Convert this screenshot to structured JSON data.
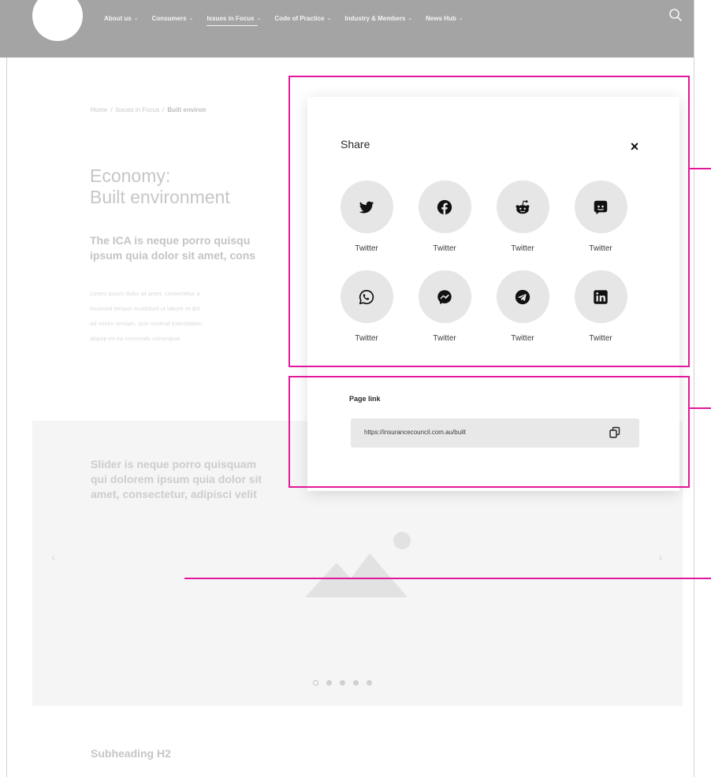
{
  "nav": {
    "items": [
      {
        "label": "About us",
        "chevron": "⌄"
      },
      {
        "label": "Consumers",
        "chevron": "⌄"
      },
      {
        "label": "Issues in Focus",
        "chevron": "⌄"
      },
      {
        "label": "Code of Practice",
        "chevron": "⌄"
      },
      {
        "label": "Industry & Members",
        "chevron": "⌄"
      },
      {
        "label": "News Hub",
        "chevron": "⌄"
      }
    ],
    "active_item": "Issues in Focus",
    "search_icon": "search-icon"
  },
  "breadcrumb": {
    "home": "Home",
    "section": "Issues in Focus",
    "current": "Built environ",
    "separator": "/"
  },
  "page": {
    "title_line1": "Economy:",
    "title_line2": "Built environment",
    "intro_line1": "The ICA is neque porro quisqu",
    "intro_line2": "ipsum quia dolor sit amet, cons",
    "body_lines": [
      "Lorem ipsum dolor sit amet, consectetur a",
      "eiusmod tempor incididunt ut labore et dol",
      "ad minim veniam, quis nostrud exercitation",
      "aliquip ex ea commodo consequat."
    ],
    "subheading": "Subheading H2"
  },
  "slider": {
    "text_line1": "Slider is neque porro quisquam",
    "text_line2": "qui dolorem ipsum quia dolor sit",
    "text_line3": "amet, consectetur, adipisci velit",
    "prev_arrow": "‹",
    "next_arrow": "›",
    "dot_count": 5,
    "active_dot": 0,
    "image_icon": "image-placeholder-icon"
  },
  "share_modal": {
    "title": "Share",
    "close_label": "×",
    "items": [
      {
        "label": "Twitter",
        "icon": "twitter-icon"
      },
      {
        "label": "Twitter",
        "icon": "facebook-icon"
      },
      {
        "label": "Twitter",
        "icon": "reddit-icon"
      },
      {
        "label": "Twitter",
        "icon": "discord-icon"
      },
      {
        "label": "Twitter",
        "icon": "whatsapp-icon"
      },
      {
        "label": "Twitter",
        "icon": "messenger-icon"
      },
      {
        "label": "Twitter",
        "icon": "telegram-icon"
      },
      {
        "label": "Twitter",
        "icon": "linkedin-icon"
      }
    ],
    "page_link_label": "Page link",
    "page_link_url": "https://insurancecouncil.com.au/built",
    "copy_icon": "copy-icon"
  },
  "colors": {
    "nav_bg": "#a4a4a4",
    "annotation": "#e2179b",
    "icon_circle": "#e6e6e6",
    "link_field": "#e8e8e8"
  }
}
